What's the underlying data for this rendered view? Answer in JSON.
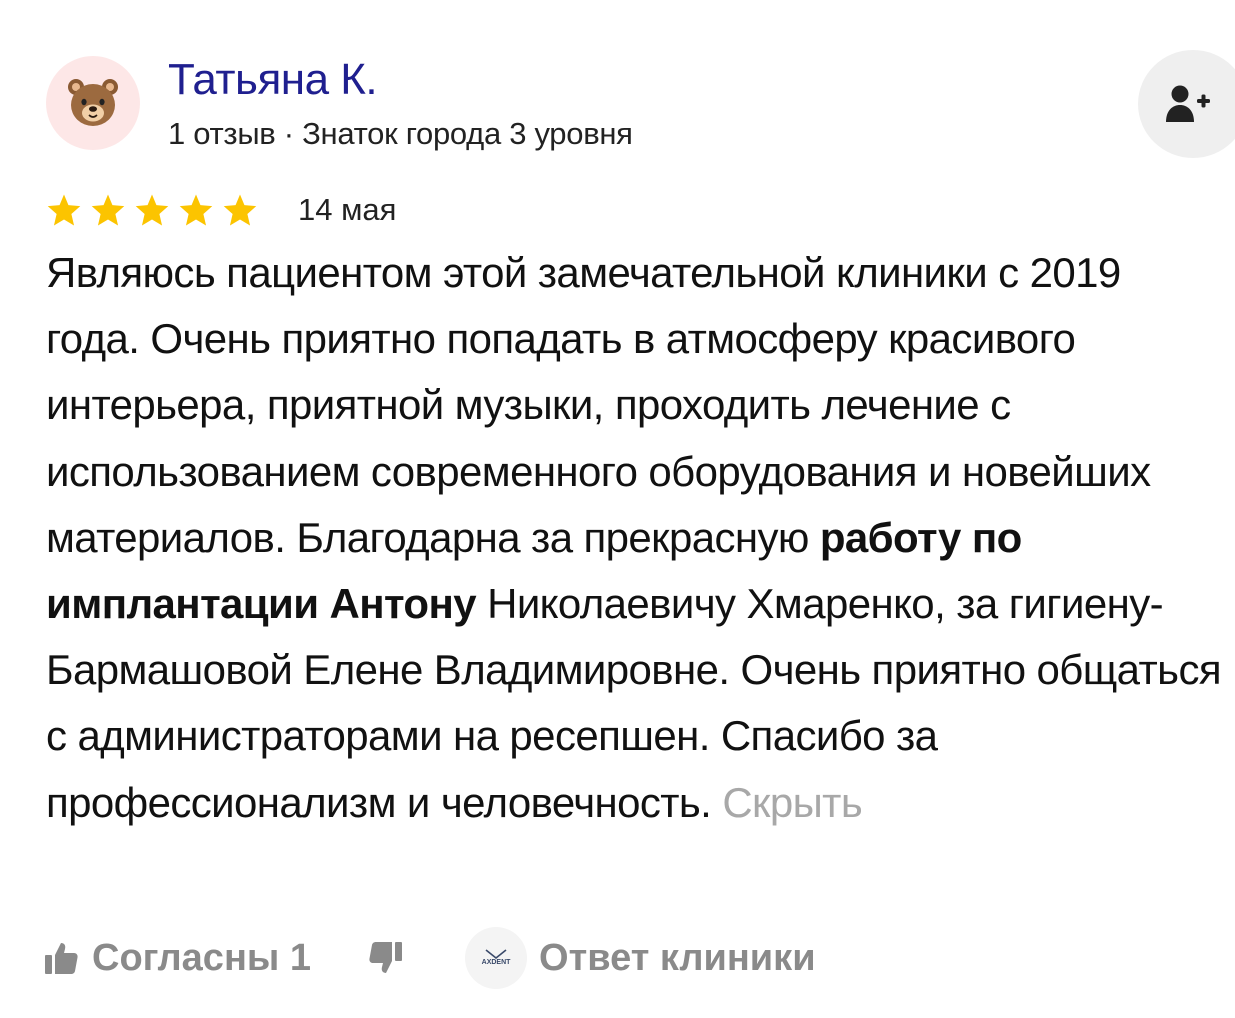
{
  "author": {
    "name": "Татьяна К.",
    "meta": "1 отзыв · Знаток города 3 уровня",
    "avatar_icon": "bear-emoji-icon"
  },
  "subscribe": {
    "icon": "add-user-icon"
  },
  "review": {
    "rating": 5,
    "max_rating": 5,
    "star_color": "#fcc400",
    "date": "14 мая",
    "text_before_bold": "Являюсь пациентом этой замечательной клиники с 2019 года. Очень приятно попадать в атмосферу красивого интерьера, приятной музыки, проходить лечение с использованием современного оборудования и новейших материалов. Благодарна за прекрасную ",
    "text_bold": "работу по имплантации Антону",
    "text_after_bold": " Николаевичу Хмаренко, за гигиену- Бармашовой Елене Владимировне. Очень приятно общаться с администраторами на ресепшен. Спасибо за профессионализм и человечность. ",
    "hide_label": "Скрыть"
  },
  "actions": {
    "like_label": "Согласны 1",
    "like_icon": "thumbs-up-icon",
    "dislike_icon": "thumbs-down-icon",
    "clinic_logo_text": "AXDENT",
    "reply_label": "Ответ клиники"
  }
}
